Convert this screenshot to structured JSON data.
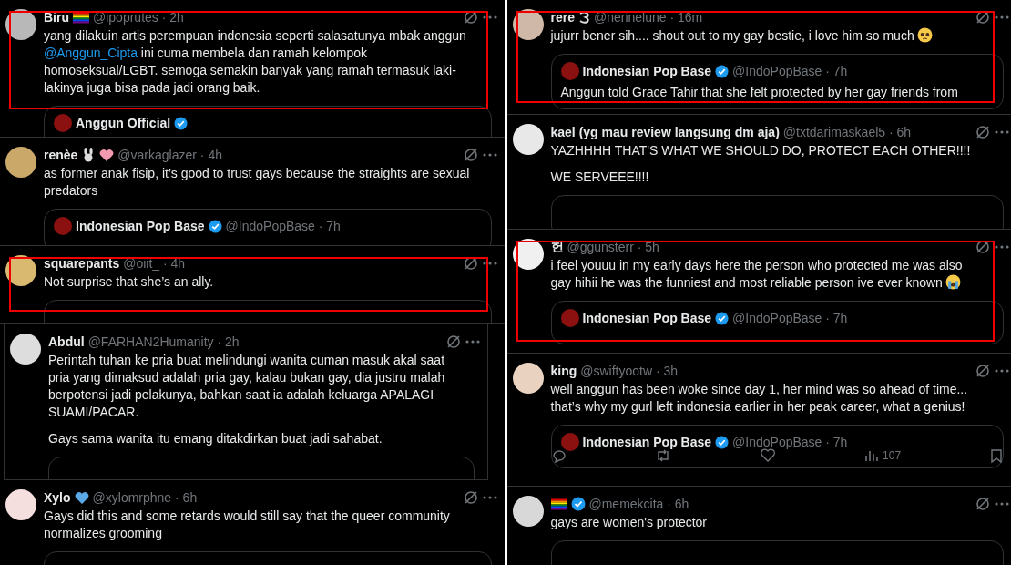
{
  "columns": [
    {
      "tweets": [
        {
          "name": "Biru",
          "badges": [
            {
              "kind": "rainbow-flag"
            }
          ],
          "meta": "@ipoprutes · 2h",
          "highlighted": true,
          "paragraphs": [
            [
              {
                "kind": "plain",
                "text": "yang dilakuin artis perempuan indonesia seperti salasatunya mbak anggun "
              },
              {
                "kind": "mention",
                "text": "@Anggun_Cipta"
              },
              {
                "kind": "plain",
                "text": " ini cuma membela dan ramah kelompok homoseksual/LGBT. semoga semakin banyak yang ramah termasuk laki-lakinya juga bisa pada jadi orang baik."
              }
            ]
          ],
          "quote": {
            "kind": "card",
            "name": "Anggun Official",
            "verified": true
          }
        },
        {
          "name": "renèe",
          "badges": [
            {
              "kind": "bunny"
            },
            {
              "kind": "heart"
            }
          ],
          "meta": "@varkaglazer · 4h",
          "highlighted": false,
          "paragraphs": [
            [
              {
                "kind": "plain",
                "text": "as former anak fisip, it’s good to trust gays because the straights are sexual predators"
              }
            ]
          ],
          "quote": {
            "kind": "card",
            "name": "Indonesian Pop Base",
            "verified": true,
            "meta": "@IndoPopBase · 7h"
          }
        },
        {
          "name": "squarepants",
          "meta": "@oiit_ · 4h",
          "highlighted": true,
          "paragraphs": [
            [
              {
                "kind": "plain",
                "text": "Not surprise that she’s an ally."
              }
            ]
          ],
          "quote": {
            "kind": "card"
          }
        },
        {
          "name": "Abdul",
          "meta": "@FARHAN2Humanity · 2h",
          "highlighted": false,
          "paragraphs": [
            [
              {
                "kind": "plain",
                "text": "Perintah tuhan ke pria buat melindungi wanita cuman masuk akal saat pria yang dimaksud adalah pria gay, kalau bukan gay, dia justru malah berpotensi jadi pelakunya, bahkan saat ia adalah keluarga APALAGI SUAMI/PACAR."
              }
            ],
            [
              {
                "kind": "plain",
                "text": "Gays sama wanita itu emang ditakdirkan buat jadi sahabat."
              }
            ]
          ],
          "quote": {
            "kind": "card"
          }
        },
        {
          "name": "Xylo",
          "badges": [
            {
              "kind": "blue-heart"
            }
          ],
          "meta": "@xylomrphne · 6h",
          "highlighted": false,
          "paragraphs": [
            [
              {
                "kind": "plain",
                "text": "Gays did this and some retards would still say that the queer community normalizes grooming"
              }
            ]
          ],
          "quote": {
            "kind": "card"
          }
        }
      ]
    },
    {
      "tweets": [
        {
          "name": "rere",
          "badges": [
            {
              "kind": "swirl"
            }
          ],
          "meta": "@nerinelune · 16m",
          "highlighted": true,
          "paragraphs": [
            [
              {
                "kind": "plain",
                "text": "jujurr bener sih.... shout out to my gay bestie, i love him so much"
              },
              {
                "kind": "pleading-emoji"
              }
            ]
          ],
          "quote": {
            "kind": "card",
            "name": "Indonesian Pop Base",
            "verified": true,
            "meta": "@IndoPopBase · 7h",
            "text": "Anggun told Grace Tahir that she felt protected by her gay friends from"
          }
        },
        {
          "name": "kael (yg mau review langsung dm aja)",
          "meta": "@txtdarimaskael5 · 6h",
          "highlighted": false,
          "paragraphs": [
            [
              {
                "kind": "plain",
                "text": "YAZHHHH THAT'S WHAT WE SHOULD DO, PROTECT EACH OTHER!!!!"
              }
            ],
            [
              {
                "kind": "plain",
                "text": "WE SERVEEE!!!!"
              }
            ]
          ],
          "quote": {
            "kind": "card"
          }
        },
        {
          "name": "헌",
          "meta": "@ggunsterr · 5h",
          "highlighted": true,
          "paragraphs": [
            [
              {
                "kind": "plain",
                "text": "i feel youuu in my early days here the person who protected me was also gay hihii he was the funniest and most reliable person ive ever known"
              },
              {
                "kind": "crying-emoji"
              }
            ]
          ],
          "quote": {
            "kind": "card",
            "name": "Indonesian Pop Base",
            "verified": true,
            "meta": "@IndoPopBase · 7h"
          }
        },
        {
          "name": "king",
          "meta": "@swiftyootw · 3h",
          "highlighted": false,
          "paragraphs": [
            [
              {
                "kind": "plain",
                "text": "well anggun has been woke since day 1, her mind was so ahead of time... that’s why my gurl left indonesia earlier in her peak career, what a genius!"
              }
            ]
          ],
          "quote": {
            "kind": "card",
            "name": "Indonesian Pop Base",
            "verified": true,
            "meta": "@IndoPopBase · 7h"
          },
          "actions": [
            {
              "kind": "reply"
            },
            {
              "kind": "repost"
            },
            {
              "kind": "like"
            },
            {
              "kind": "views",
              "count": "107"
            },
            {
              "kind": "bookmark"
            }
          ]
        },
        {
          "badges": [
            {
              "kind": "rainbow-flag"
            },
            {
              "kind": "verified"
            }
          ],
          "meta": "@memekcita · 6h",
          "highlighted": false,
          "paragraphs": [
            [
              {
                "kind": "plain",
                "text": "gays are women's protector"
              }
            ]
          ],
          "quote": {
            "kind": "card"
          }
        }
      ]
    }
  ]
}
